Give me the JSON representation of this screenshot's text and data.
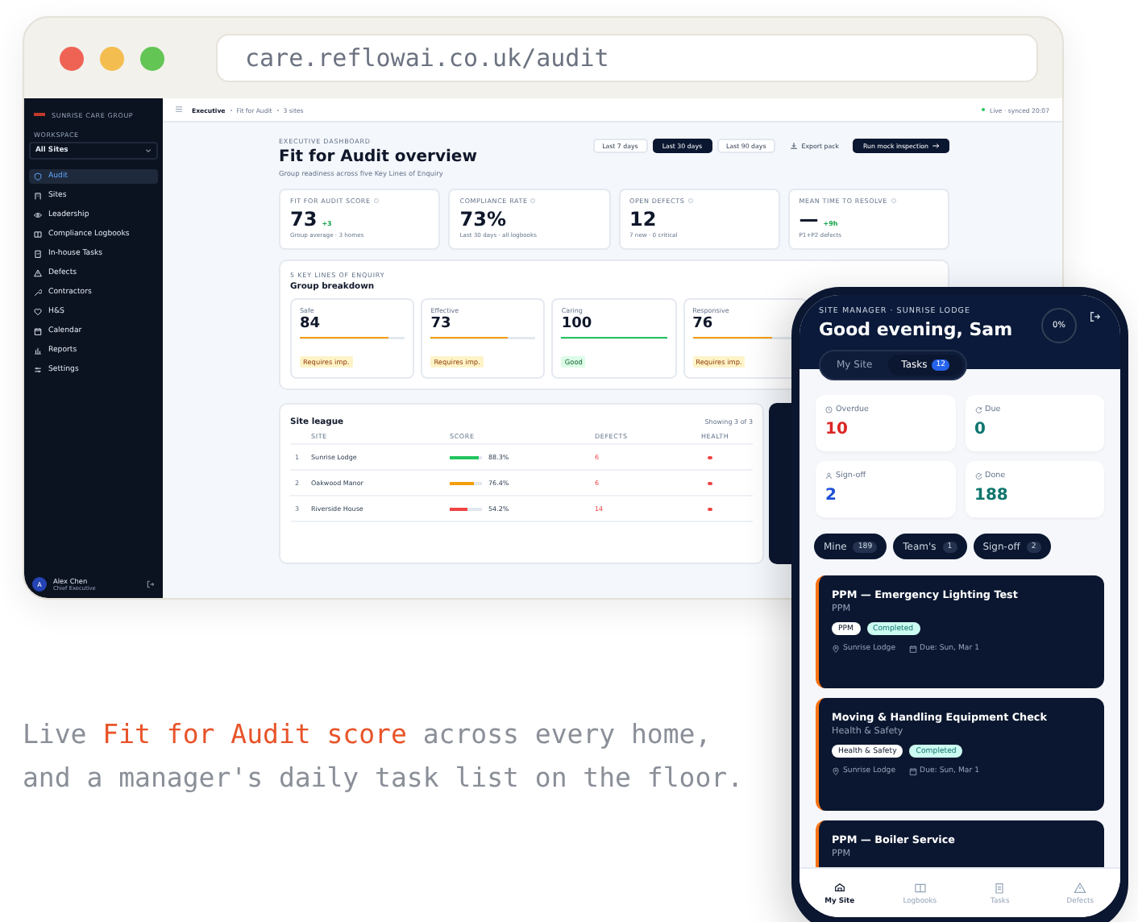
{
  "browser": {
    "url": "care.reflowai.co.uk/audit"
  },
  "sidebar": {
    "org": "SUNRISE CARE GROUP",
    "section": "WORKSPACE",
    "site_picker": "All Sites",
    "items": [
      {
        "label": "Audit",
        "selected": true
      },
      {
        "label": "Sites",
        "selected": false
      },
      {
        "label": "Leadership",
        "selected": false
      },
      {
        "label": "Compliance Logbooks",
        "selected": false
      },
      {
        "label": "In-house Tasks",
        "selected": false
      },
      {
        "label": "Defects",
        "selected": false
      },
      {
        "label": "Contractors",
        "selected": false
      },
      {
        "label": "H&S",
        "selected": false
      },
      {
        "label": "Calendar",
        "selected": false
      },
      {
        "label": "Reports",
        "selected": false
      },
      {
        "label": "Settings",
        "selected": false
      }
    ],
    "user": {
      "initial": "A",
      "name": "Alex Chen",
      "role": "Chief Executive"
    }
  },
  "topbar": {
    "crumbs": [
      "Executive",
      "Fit for Audit",
      "3 sites"
    ],
    "status": "Live · synced 20:07"
  },
  "header": {
    "eyebrow": "EXECUTIVE DASHBOARD",
    "title": "Fit for Audit overview",
    "subtitle": "Group readiness across five Key Lines of Enquiry",
    "ranges": [
      {
        "label": "Last 7 days",
        "selected": false
      },
      {
        "label": "Last 30 days",
        "selected": true
      },
      {
        "label": "Last 90 days",
        "selected": false
      }
    ],
    "export": "Export pack",
    "run": "Run mock inspection"
  },
  "kpis": [
    {
      "label": "FIT FOR AUDIT SCORE",
      "value": "73",
      "delta": "+3",
      "note": "Group average · 3 homes"
    },
    {
      "label": "COMPLIANCE RATE",
      "value": "73%",
      "note": "Last 30 days · all logbooks"
    },
    {
      "label": "OPEN DEFECTS",
      "value": "12",
      "note": "7 new · 0 critical"
    },
    {
      "label": "MEAN TIME TO RESOLVE",
      "value": "—",
      "delta": "+9h",
      "note": "P1+P2 defects"
    }
  ],
  "kloe": {
    "eyebrow": "5 KEY LINES OF ENQUIRY",
    "title": "Group breakdown",
    "items": [
      {
        "name": "Safe",
        "value": "84",
        "level": 0.84,
        "status": "Requires imp.",
        "kind": "warn"
      },
      {
        "name": "Effective",
        "value": "73",
        "level": 0.73,
        "status": "Requires imp.",
        "kind": "warn"
      },
      {
        "name": "Caring",
        "value": "100",
        "level": 1,
        "status": "Good",
        "kind": "good"
      },
      {
        "name": "Responsive",
        "value": "76",
        "level": 0.76,
        "status": "Requires imp.",
        "kind": "warn"
      }
    ]
  },
  "league": {
    "title": "Site league",
    "count": "Showing 3 of 3",
    "columns": [
      "SITE",
      "SCORE",
      "DEFECTS",
      "HEALTH"
    ],
    "rows": [
      {
        "rank": "1",
        "site": "Sunrise Lodge",
        "level": 0.883,
        "score": "88.3%",
        "defects": "6",
        "color": "#22c55e"
      },
      {
        "rank": "2",
        "site": "Oakwood Manor",
        "level": 0.764,
        "score": "76.4%",
        "defects": "6",
        "color": "#f59e0b"
      },
      {
        "rank": "3",
        "site": "Riverside House",
        "level": 0.542,
        "score": "54.2%",
        "defects": "14",
        "color": "#ef4444"
      }
    ]
  },
  "phone": {
    "eyebrow": "SITE MANAGER · SUNRISE LODGE",
    "greeting": "Good evening, Sam",
    "progress": "0%",
    "tabs": [
      {
        "label": "My Site",
        "selected": false
      },
      {
        "label": "Tasks",
        "count": "12",
        "selected": true
      }
    ],
    "stats": [
      {
        "label": "Overdue",
        "value": "10",
        "color": "#dc2626"
      },
      {
        "label": "Due",
        "value": "0",
        "color": "#0f766e"
      },
      {
        "label": "Sign-off",
        "value": "2",
        "color": "#1d4ed8"
      },
      {
        "label": "Done",
        "value": "188",
        "color": "#0f766e"
      }
    ],
    "filters": [
      {
        "label": "Mine",
        "count": "189"
      },
      {
        "label": "Team's",
        "count": "1"
      },
      {
        "label": "Sign-off",
        "count": "2"
      }
    ],
    "tasks": [
      {
        "title": "PPM — Emergency Lighting Test",
        "category": "PPM",
        "tag": "PPM",
        "status": "Completed",
        "site": "Sunrise Lodge",
        "due": "Due: Sun, Mar 1"
      },
      {
        "title": "Moving & Handling Equipment Check",
        "category": "Health & Safety",
        "tag": "Health & Safety",
        "status": "Completed",
        "site": "Sunrise Lodge",
        "due": "Due: Sun, Mar 1"
      },
      {
        "title": "PPM — Boiler Service",
        "category": "PPM"
      }
    ],
    "nav": [
      {
        "label": "My Site",
        "selected": true
      },
      {
        "label": "Logbooks",
        "selected": false
      },
      {
        "label": "Tasks",
        "selected": false
      },
      {
        "label": "Defects",
        "selected": false
      }
    ]
  },
  "caption": "Live **Fit for Audit score** across every home, and a manager's daily task list on the floor."
}
